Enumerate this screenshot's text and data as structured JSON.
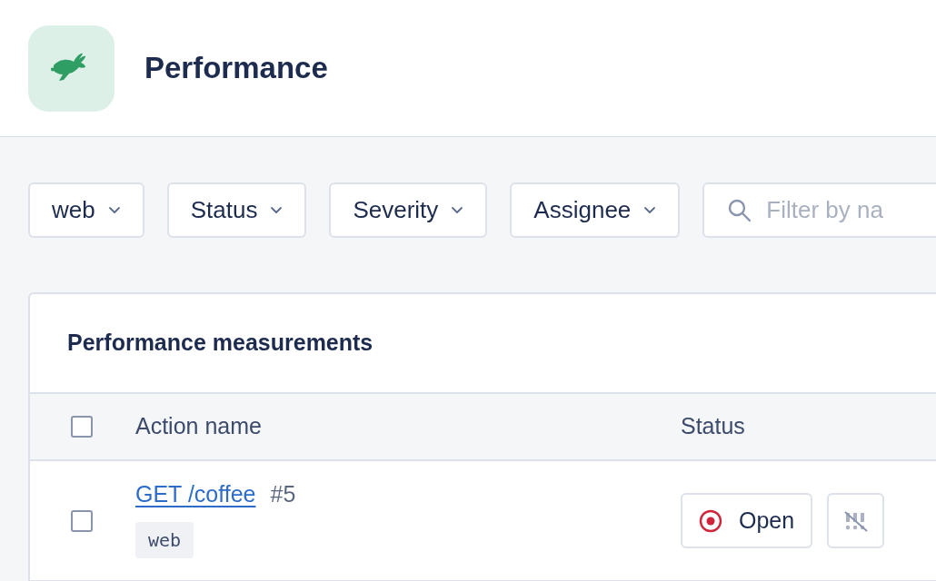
{
  "header": {
    "title": "Performance"
  },
  "filters": [
    {
      "label": "web"
    },
    {
      "label": "Status"
    },
    {
      "label": "Severity"
    },
    {
      "label": "Assignee"
    }
  ],
  "search": {
    "placeholder": "Filter by na"
  },
  "card": {
    "title": "Performance measurements",
    "columns": [
      "Action name",
      "Status"
    ],
    "header_checkbox": {
      "checked": false
    },
    "rows": [
      {
        "checked": false,
        "name": "GET /coffee",
        "number": "#5",
        "tag": "web",
        "status": "Open"
      }
    ]
  }
}
